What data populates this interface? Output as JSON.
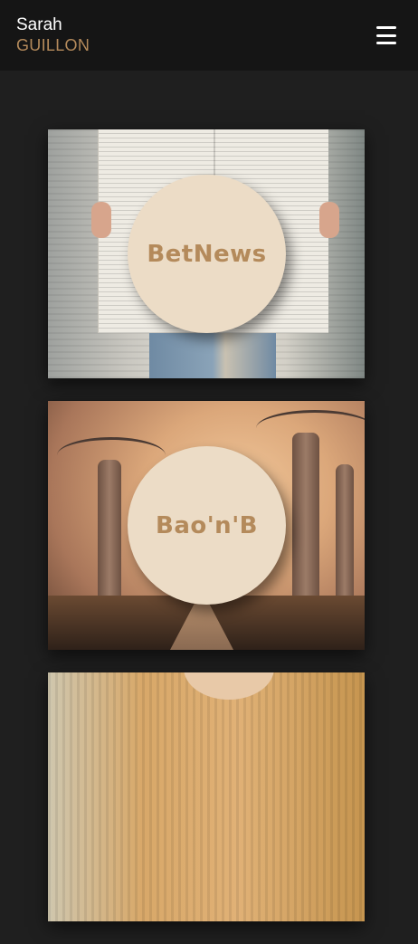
{
  "header": {
    "first_name": "Sarah",
    "last_name": "GUILLON",
    "menu_icon": "hamburger-menu-icon"
  },
  "projects": [
    {
      "label": "BetNews",
      "image": "newspaper-photo"
    },
    {
      "label": "Bao'n'B",
      "image": "baobab-avenue-photo"
    },
    {
      "label": "",
      "image": "knit-sweater-photo"
    }
  ],
  "colors": {
    "accent": "#b48a5b",
    "header_bg": "#151515",
    "page_bg": "#1f1f1f",
    "circle_bg": "#ecdcc6"
  }
}
